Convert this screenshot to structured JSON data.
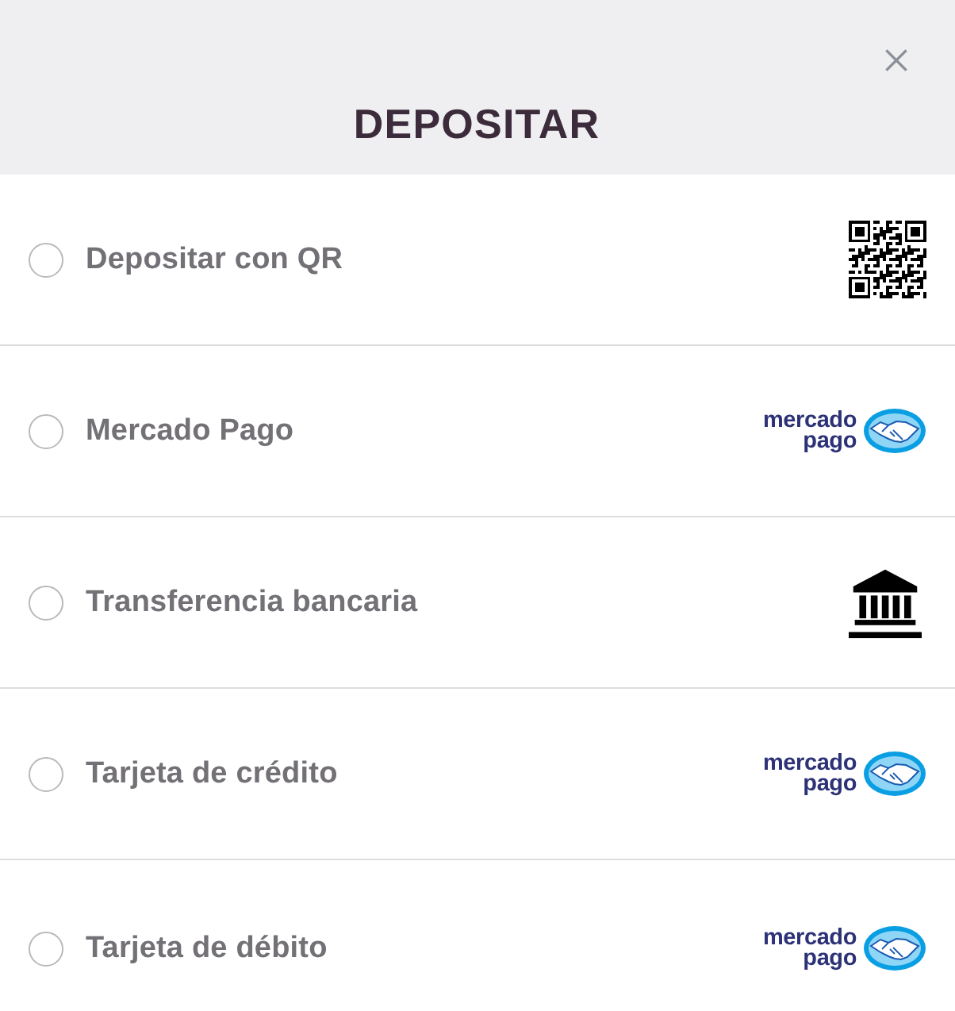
{
  "header": {
    "title": "DEPOSITAR"
  },
  "options": [
    {
      "label": "Depositar con QR",
      "selected": false,
      "icon": {
        "kind": "qr"
      }
    },
    {
      "label": "Mercado Pago",
      "selected": false,
      "icon": {
        "kind": "mercadopago",
        "wordmark": [
          "mercado",
          "pago"
        ]
      }
    },
    {
      "label": "Transferencia bancaria",
      "selected": false,
      "icon": {
        "kind": "bank"
      }
    },
    {
      "label": "Tarjeta de crédito",
      "selected": false,
      "icon": {
        "kind": "mercadopago",
        "wordmark": [
          "mercado",
          "pago"
        ]
      }
    },
    {
      "label": "Tarjeta de débito",
      "selected": false,
      "icon": {
        "kind": "mercadopago",
        "wordmark": [
          "mercado",
          "pago"
        ]
      }
    }
  ]
}
